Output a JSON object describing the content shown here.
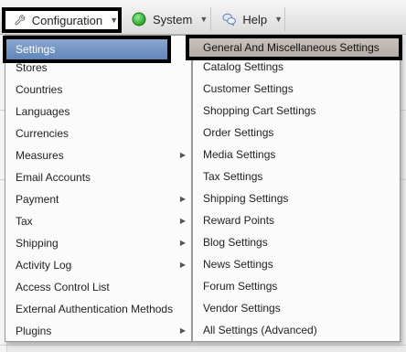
{
  "menubar": {
    "configuration_label": "Configuration",
    "system_label": "System",
    "help_label": "Help"
  },
  "config_menu": {
    "items": [
      {
        "label": "Settings",
        "has_submenu": true
      },
      {
        "label": "Stores",
        "has_submenu": false
      },
      {
        "label": "Countries",
        "has_submenu": false
      },
      {
        "label": "Languages",
        "has_submenu": false
      },
      {
        "label": "Currencies",
        "has_submenu": false
      },
      {
        "label": "Measures",
        "has_submenu": true
      },
      {
        "label": "Email Accounts",
        "has_submenu": false
      },
      {
        "label": "Payment",
        "has_submenu": true
      },
      {
        "label": "Tax",
        "has_submenu": true
      },
      {
        "label": "Shipping",
        "has_submenu": true
      },
      {
        "label": "Activity Log",
        "has_submenu": true
      },
      {
        "label": "Access Control List",
        "has_submenu": false
      },
      {
        "label": "External Authentication Methods",
        "has_submenu": false
      },
      {
        "label": "Plugins",
        "has_submenu": true
      }
    ]
  },
  "settings_menu": {
    "items": [
      {
        "label": "General And Miscellaneous Settings"
      },
      {
        "label": "Catalog Settings"
      },
      {
        "label": "Customer Settings"
      },
      {
        "label": "Shopping Cart Settings"
      },
      {
        "label": "Order Settings"
      },
      {
        "label": "Media Settings"
      },
      {
        "label": "Tax Settings"
      },
      {
        "label": "Shipping Settings"
      },
      {
        "label": "Reward Points"
      },
      {
        "label": "Blog Settings"
      },
      {
        "label": "News Settings"
      },
      {
        "label": "Forum Settings"
      },
      {
        "label": "Vendor Settings"
      },
      {
        "label": "All Settings (Advanced)"
      }
    ]
  },
  "icons": {
    "configuration": "wrench-icon",
    "system": "green-circle-icon",
    "help": "speech-bubbles-icon",
    "submenu": "triangle-right-icon",
    "dropdown": "triangle-down-icon"
  },
  "colors": {
    "highlight_blue": "#6f91c3",
    "highlight_gray": "#bdb5af",
    "outline": "#000000",
    "system_green": "#2fb82f"
  }
}
